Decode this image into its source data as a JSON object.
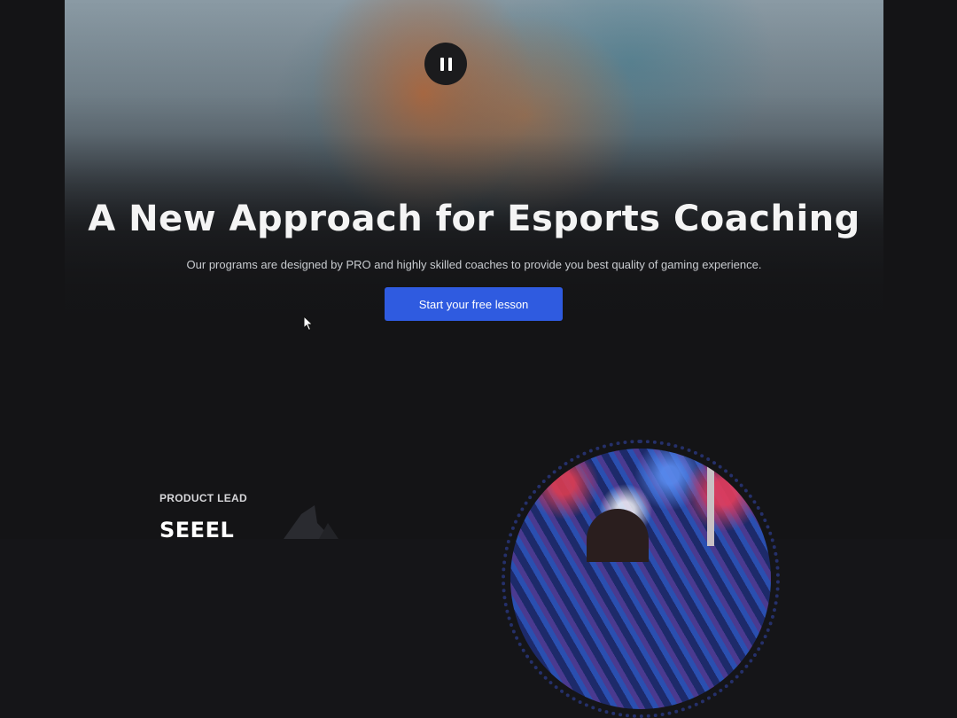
{
  "hero": {
    "title": "A New Approach for Esports Coaching",
    "subtitle": "Our programs are designed by PRO and highly skilled coaches to provide you best quality of gaming experience.",
    "cta_label": "Start your free lesson",
    "pause_icon": "pause-icon"
  },
  "profile": {
    "label": "PRODUCT LEAD",
    "name": "SEEEL"
  },
  "colors": {
    "background": "#141416",
    "accent": "#2f5be0",
    "ring": "#25306a"
  }
}
